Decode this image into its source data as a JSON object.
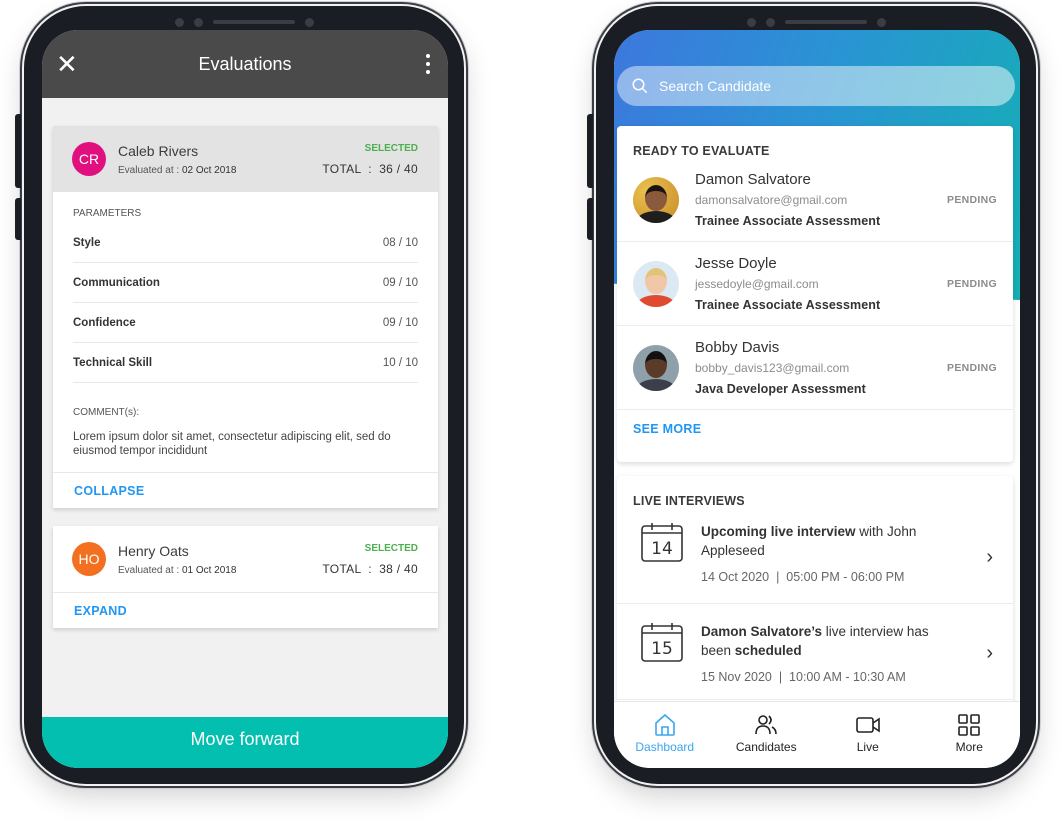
{
  "left_phone": {
    "appbar": {
      "close_icon": "close-icon",
      "title": "Evaluations",
      "menu_icon": "kebab-menu-icon"
    },
    "evaluations": [
      {
        "initials": "CR",
        "avatar_color": "#e0117f",
        "name": "Caleb Rivers",
        "evaluated_label": "Evaluated at : ",
        "evaluated_date": "02 Oct 2018",
        "status": "SELECTED",
        "total_label": "TOTAL  :  ",
        "total_value": "36 / 40",
        "expanded": true,
        "parameters_label": "PARAMETERS",
        "parameters": [
          {
            "name": "Style",
            "score": "08 / 10"
          },
          {
            "name": "Communication",
            "score": "09 / 10"
          },
          {
            "name": "Confidence",
            "score": "09 / 10"
          },
          {
            "name": "Technical Skill",
            "score": "10 / 10"
          }
        ],
        "comments_label": "COMMENT(s):",
        "comment": "Lorem ipsum dolor sit amet, consectetur adipiscing elit, sed do eiusmod tempor incididunt",
        "toggle_label": "COLLAPSE"
      },
      {
        "initials": "HO",
        "avatar_color": "#f37021",
        "name": "Henry Oats",
        "evaluated_label": "Evaluated at : ",
        "evaluated_date": "01 Oct 2018",
        "status": "SELECTED",
        "total_label": "TOTAL  :  ",
        "total_value": "38 / 40",
        "expanded": false,
        "toggle_label": "EXPAND"
      }
    ],
    "primary_action": "Move forward",
    "colors": {
      "appbar": "#4a4a4a",
      "selected": "#4caf50",
      "link": "#2196f3",
      "primary_action": "#03bfb0"
    }
  },
  "right_phone": {
    "search": {
      "placeholder": "Search Candidate",
      "value": ""
    },
    "ready_to_evaluate": {
      "title": "READY TO EVALUATE",
      "candidates": [
        {
          "name": "Damon Salvatore",
          "email": "damonsalvatore@gmail.com",
          "assessment": "Trainee Associate Assessment",
          "status": "PENDING"
        },
        {
          "name": "Jesse Doyle",
          "email": "jessedoyle@gmail.com",
          "assessment": "Trainee Associate Assessment",
          "status": "PENDING"
        },
        {
          "name": "Bobby Davis",
          "email": "bobby_davis123@gmail.com",
          "assessment": "Java Developer Assessment",
          "status": "PENDING"
        }
      ],
      "see_more": "SEE MORE"
    },
    "live_interviews": {
      "title": "LIVE INTERVIEWS",
      "items": [
        {
          "day": "14",
          "title_bold": "Upcoming live interview",
          "title_rest": " with John Appleseed",
          "date": "14 Oct 2020",
          "separator": "|",
          "time": "05:00 PM - 06:00 PM"
        },
        {
          "day": "15",
          "title_bold": "Damon Salvatore’s",
          "title_rest": " live interview has been ",
          "title_bold2": "scheduled",
          "date": "15 Nov 2020",
          "separator": "|",
          "time": "10:00 AM - 10:30 AM"
        }
      ]
    },
    "bottom_nav": [
      {
        "label": "Dashboard",
        "icon": "home-icon",
        "active": true
      },
      {
        "label": "Candidates",
        "icon": "users-icon",
        "active": false
      },
      {
        "label": "Live",
        "icon": "video-camera-icon",
        "active": false
      },
      {
        "label": "More",
        "icon": "grid-icon",
        "active": false
      }
    ],
    "colors": {
      "gradient_start": "#3c78dd",
      "gradient_end": "#14b0b4",
      "link": "#2196f3",
      "nav_active": "#3aa6ef"
    }
  }
}
